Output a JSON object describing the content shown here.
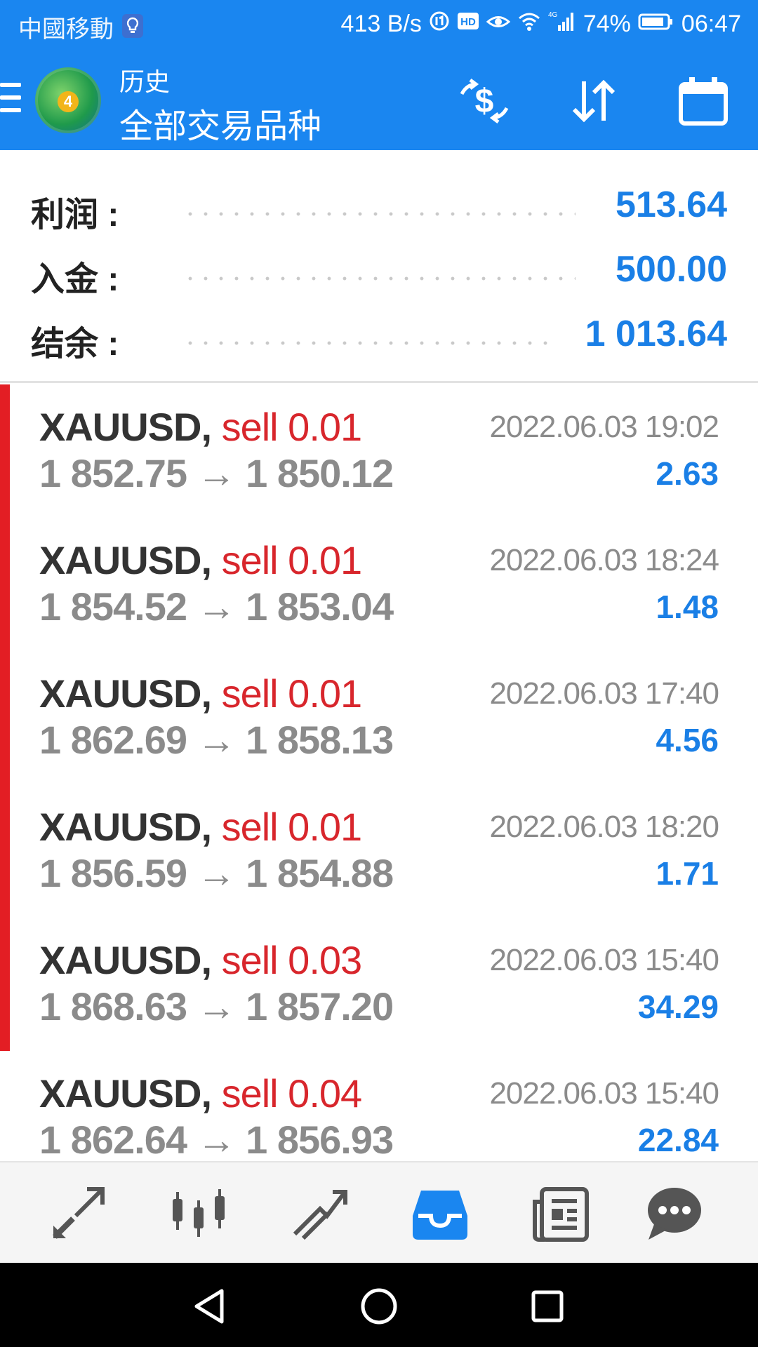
{
  "status_bar": {
    "carrier": "中國移動",
    "net_speed": "413 B/s",
    "hd": "HD",
    "net_type": "4G",
    "battery": "74%",
    "time": "06:47"
  },
  "header": {
    "subtitle": "历史",
    "title": "全部交易品种",
    "logo_badge": "4",
    "icons": [
      "menu-icon",
      "deposit-exchange-icon",
      "sort-icon",
      "calendar-icon"
    ]
  },
  "summary": {
    "profit_label": "利润 :",
    "profit_value": "513.64",
    "deposit_label": "入金 :",
    "deposit_value": "500.00",
    "balance_label": "结余 :",
    "balance_value": "1 013.64"
  },
  "deals": [
    {
      "symbol": "XAUUSD,",
      "side": "sell 0.01",
      "open": "1 852.75",
      "arrow": "→",
      "close": "1 850.12",
      "datetime": "2022.06.03 19:02",
      "profit": "2.63"
    },
    {
      "symbol": "XAUUSD,",
      "side": "sell 0.01",
      "open": "1 854.52",
      "arrow": "→",
      "close": "1 853.04",
      "datetime": "2022.06.03 18:24",
      "profit": "1.48"
    },
    {
      "symbol": "XAUUSD,",
      "side": "sell 0.01",
      "open": "1 862.69",
      "arrow": "→",
      "close": "1 858.13",
      "datetime": "2022.06.03 17:40",
      "profit": "4.56"
    },
    {
      "symbol": "XAUUSD,",
      "side": "sell 0.01",
      "open": "1 856.59",
      "arrow": "→",
      "close": "1 854.88",
      "datetime": "2022.06.03 18:20",
      "profit": "1.71"
    },
    {
      "symbol": "XAUUSD,",
      "side": "sell 0.03",
      "open": "1 868.63",
      "arrow": "→",
      "close": "1 857.20",
      "datetime": "2022.06.03 15:40",
      "profit": "34.29"
    },
    {
      "symbol": "XAUUSD,",
      "side": "sell 0.04",
      "open": "1 862.64",
      "arrow": "→",
      "close": "1 856.93",
      "datetime": "2022.06.03 15:40",
      "profit": "22.84"
    }
  ],
  "tabs": [
    "quotes-icon",
    "chart-icon",
    "trade-icon",
    "history-icon",
    "news-icon",
    "chat-icon"
  ],
  "active_tab": "history-icon",
  "colors": {
    "accent": "#1a86f0",
    "sell": "#d8262c",
    "profit": "#1a7fe6",
    "muted": "#8b8b8b"
  }
}
